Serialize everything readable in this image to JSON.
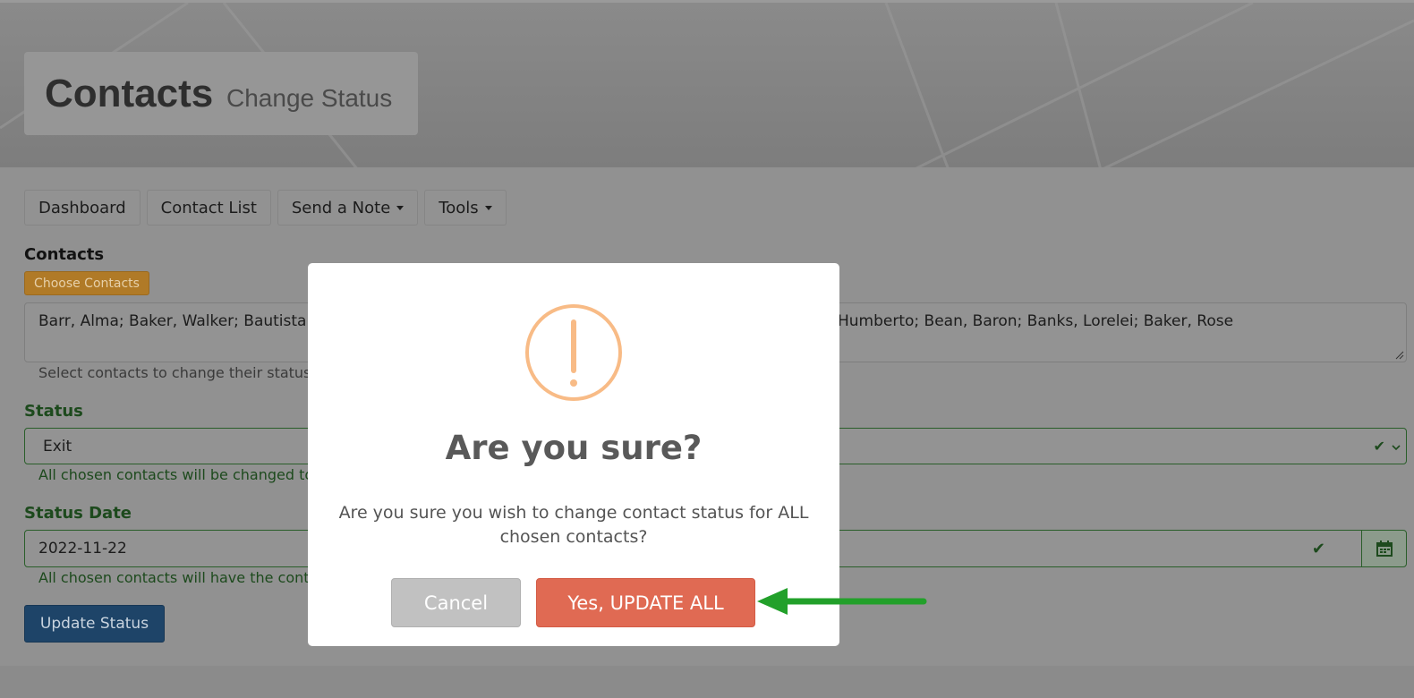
{
  "header": {
    "title": "Contacts",
    "subtitle": "Change Status"
  },
  "nav": {
    "items": [
      {
        "label": "Dashboard",
        "dropdown": false
      },
      {
        "label": "Contact List",
        "dropdown": false
      },
      {
        "label": "Send a Note",
        "dropdown": true
      },
      {
        "label": "Tools",
        "dropdown": true
      }
    ]
  },
  "form": {
    "contacts_label": "Contacts",
    "choose_button": "Choose Contacts",
    "contacts_value_left": "Barr, Alma; Baker, Walker; Bautista",
    "contacts_value_right": "Humberto; Bean, Baron; Banks, Lorelei; Baker, Rose",
    "contacts_help": "Select contacts to change their status",
    "status_label": "Status",
    "status_value": "Exit",
    "status_help": "All chosen contacts will be changed to",
    "date_label": "Status Date",
    "date_value": "2022-11-22",
    "date_help": "All chosen contacts will have the cont",
    "submit_button": "Update Status"
  },
  "dialog": {
    "icon": "warning-icon",
    "title": "Are you sure?",
    "message": "Are you sure you wish to change contact status for ALL chosen contacts?",
    "cancel_label": "Cancel",
    "confirm_label": "Yes, UPDATE ALL"
  },
  "colors": {
    "confirm": "#e06a53",
    "cancel": "#c1c1c1",
    "warning": "#f8bb86",
    "annotation_arrow": "#22a02a",
    "primary": "#1e4468"
  }
}
